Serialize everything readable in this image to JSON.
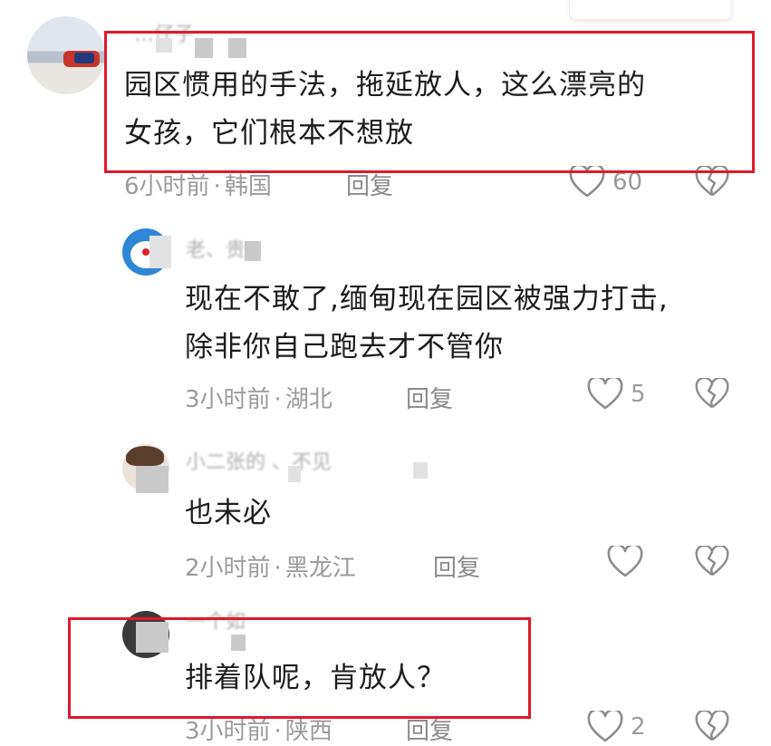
{
  "comments": [
    {
      "name": "…仔子",
      "text_lines": [
        "园区惯用的手法，拖延放人，这么漂亮的",
        "女孩，它们根本不想放"
      ],
      "time": "6小时前",
      "location": "韩国",
      "reply": "回复",
      "likes": "60"
    },
    {
      "name": "老、贵",
      "text_lines": [
        "现在不敢了,缅甸现在园区被强力打击,",
        "除非你自己跑去才不管你"
      ],
      "time": "3小时前",
      "location": "湖北",
      "reply": "回复",
      "likes": "5"
    },
    {
      "name": "小二张的 、不见",
      "text_lines": [
        "也未必"
      ],
      "time": "2小时前",
      "location": "黑龙江",
      "reply": "回复",
      "likes": ""
    },
    {
      "name": "一个如",
      "text_lines": [
        "排着队呢，肯放人？"
      ],
      "time": "3小时前",
      "location": "陕西",
      "reply": "回复",
      "likes": "2"
    }
  ],
  "meta_separator": "·",
  "colors": {
    "highlight": "#e0182d",
    "meta": "#9b9b9b",
    "icon": "#8c8c8c"
  },
  "icons": {
    "like": "heart-icon",
    "dislike": "broken-heart-icon"
  }
}
